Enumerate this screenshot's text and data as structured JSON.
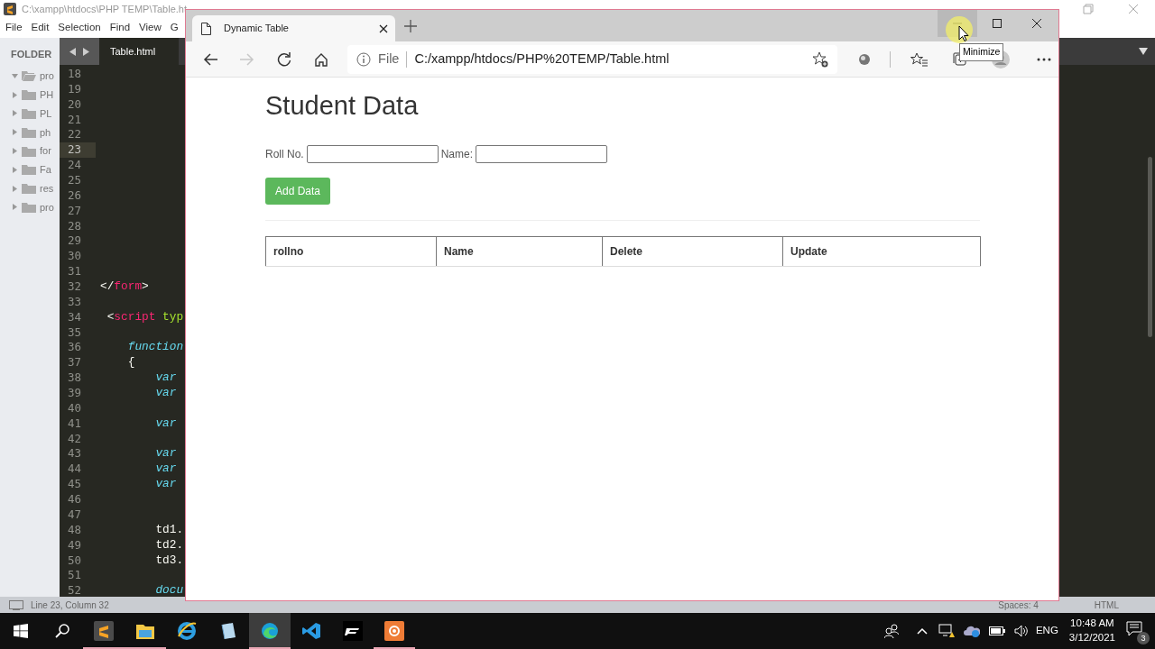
{
  "editor_window": {
    "title": "C:\\xampp\\htdocs\\PHP TEMP\\Table.ht",
    "menu": [
      "File",
      "Edit",
      "Selection",
      "Find",
      "View",
      "G"
    ],
    "sidebar": {
      "header": "FOLDER",
      "items": [
        {
          "label": "pro",
          "expanded": true
        },
        {
          "label": "PH",
          "expanded": false
        },
        {
          "label": "PL",
          "expanded": false
        },
        {
          "label": "ph",
          "expanded": false
        },
        {
          "label": "for",
          "expanded": false
        },
        {
          "label": "Fa",
          "expanded": false
        },
        {
          "label": "res",
          "expanded": false
        },
        {
          "label": "pro",
          "expanded": false
        }
      ]
    },
    "tab": "Table.html",
    "lines": [
      {
        "number": "18",
        "current": false
      },
      {
        "number": "19",
        "current": false
      },
      {
        "number": "20",
        "current": false
      },
      {
        "number": "21",
        "current": false
      },
      {
        "number": "22",
        "current": false
      },
      {
        "number": "23",
        "current": true
      },
      {
        "number": "24",
        "current": false
      },
      {
        "number": "25",
        "current": false
      },
      {
        "number": "26",
        "current": false
      },
      {
        "number": "27",
        "current": false
      },
      {
        "number": "28",
        "current": false
      },
      {
        "number": "29",
        "current": false
      },
      {
        "number": "30",
        "current": false
      },
      {
        "number": "31",
        "current": false
      },
      {
        "number": "32",
        "current": false,
        "code": [
          {
            "text": "</",
            "kind": "punct"
          },
          {
            "text": "form",
            "kind": "tag"
          },
          {
            "text": ">",
            "kind": "punct"
          }
        ]
      },
      {
        "number": "33",
        "current": false
      },
      {
        "number": "34",
        "current": false,
        "code": [
          {
            "text": " <",
            "kind": "punct"
          },
          {
            "text": "script",
            "kind": "tag"
          },
          {
            "text": " typ",
            "kind": "attr"
          }
        ]
      },
      {
        "number": "35",
        "current": false
      },
      {
        "number": "36",
        "current": false,
        "code": [
          {
            "text": "    function",
            "kind": "keyword"
          }
        ]
      },
      {
        "number": "37",
        "current": false,
        "code": [
          {
            "text": "    {",
            "kind": "plain"
          }
        ]
      },
      {
        "number": "38",
        "current": false,
        "code": [
          {
            "text": "        var",
            "kind": "keyword"
          }
        ]
      },
      {
        "number": "39",
        "current": false,
        "code": [
          {
            "text": "        var",
            "kind": "keyword"
          }
        ]
      },
      {
        "number": "40",
        "current": false
      },
      {
        "number": "41",
        "current": false,
        "code": [
          {
            "text": "        var",
            "kind": "keyword"
          }
        ]
      },
      {
        "number": "42",
        "current": false
      },
      {
        "number": "43",
        "current": false,
        "code": [
          {
            "text": "        var",
            "kind": "keyword"
          }
        ]
      },
      {
        "number": "44",
        "current": false,
        "code": [
          {
            "text": "        var",
            "kind": "keyword"
          }
        ]
      },
      {
        "number": "45",
        "current": false,
        "code": [
          {
            "text": "        var",
            "kind": "keyword"
          }
        ]
      },
      {
        "number": "46",
        "current": false
      },
      {
        "number": "47",
        "current": false
      },
      {
        "number": "48",
        "current": false,
        "code": [
          {
            "text": "        td1.",
            "kind": "plain"
          }
        ]
      },
      {
        "number": "49",
        "current": false,
        "code": [
          {
            "text": "        td2.",
            "kind": "plain"
          }
        ]
      },
      {
        "number": "50",
        "current": false,
        "code": [
          {
            "text": "        td3.",
            "kind": "plain"
          }
        ]
      },
      {
        "number": "51",
        "current": false
      },
      {
        "number": "52",
        "current": false,
        "code": [
          {
            "text": "        docu",
            "kind": "keyword"
          }
        ]
      }
    ],
    "status_bar": {
      "position": "Line 23, Column 32",
      "indentation": "Spaces: 4",
      "syntax": "HTML"
    }
  },
  "browser_window": {
    "tabs": [
      {
        "title": "Dynamic Table",
        "selected": true
      }
    ],
    "controls": [
      {
        "kind": "minimize",
        "hovered": true
      },
      {
        "kind": "maximize",
        "hovered": false
      },
      {
        "kind": "close",
        "hovered": false
      }
    ],
    "tooltip": "Minimize",
    "nav": [
      {
        "kind": "back",
        "disabled": false
      },
      {
        "kind": "forward",
        "disabled": true
      },
      {
        "kind": "refresh",
        "disabled": false
      },
      {
        "kind": "home",
        "disabled": false
      }
    ],
    "address": {
      "scheme": "File",
      "url": "C:/xampp/htdocs/PHP%20TEMP/Table.html"
    },
    "page": {
      "heading": "Student Data",
      "fields": [
        {
          "label": "Roll No."
        },
        {
          "label": "Name:"
        }
      ],
      "button": "Add Data",
      "table": {
        "columns": [
          "rollno",
          "Name",
          "Delete",
          "Update"
        ]
      }
    }
  },
  "taskbar": {
    "apps": [
      {
        "kind": "sublime",
        "running": true,
        "active": false
      },
      {
        "kind": "explorer",
        "running": true,
        "active": false
      },
      {
        "kind": "ie",
        "running": false,
        "active": false
      },
      {
        "kind": "notepad",
        "running": false,
        "active": false
      },
      {
        "kind": "edge",
        "running": true,
        "active": true
      },
      {
        "kind": "vscode",
        "running": false,
        "active": false
      },
      {
        "kind": "game",
        "running": false,
        "active": false
      },
      {
        "kind": "recorder",
        "running": true,
        "active": false
      }
    ],
    "language": "ENG",
    "time": "10:48 AM",
    "date": "3/12/2021",
    "notifications": "3"
  }
}
